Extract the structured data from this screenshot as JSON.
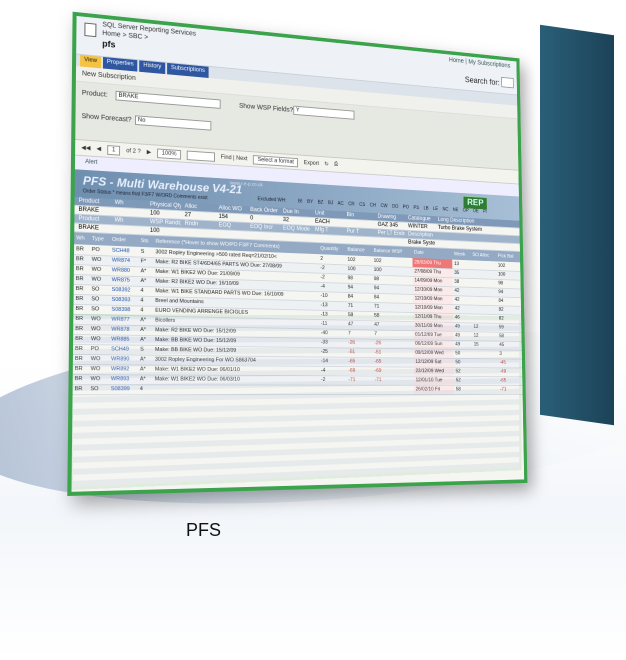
{
  "window": {
    "app_title": "SQL Server Reporting Services",
    "breadcrumb": "Home > SBC >",
    "page_title": "pfs",
    "home_link": "Home | My Subscriptions",
    "search_label": "Search for:"
  },
  "tabs": [
    "View",
    "Properties",
    "History",
    "Subscriptions"
  ],
  "subscription_link": "New Subscription",
  "params": {
    "product_label": "Product:",
    "product_value": "BRAKE",
    "show_wsp_label": "Show WSP Fields?",
    "show_wsp_value": "Y",
    "show_forecast_label": "Show Forecast?",
    "show_forecast_value": "No"
  },
  "toolbar": {
    "page": "1",
    "of_pages": "of 2 ?",
    "zoom": "100%",
    "find_next": "Find | Next",
    "format": "Select a format",
    "export": "Export"
  },
  "alert_label": "Alert",
  "report": {
    "title": "PFS - Multi Warehouse V4-21",
    "url": "www.r-e-p.co.uk",
    "logo": "REP",
    "note": "Order Status * means that F3/F7 W/ORD Comments exist",
    "excluded": "Excluded WH:",
    "categories": "BI BY BZ BJ AC CR CS CH CW DO PO PS LB LE NC NE OP OE PI"
  },
  "info_rows": [
    [
      "Product",
      "Wh",
      "Physical Qty",
      "Alloc",
      "Alloc WO",
      "Back Order Qty",
      "Due In",
      "Unit",
      "Bin",
      "Drawing",
      "Catalogue",
      "Long Description"
    ],
    [
      "BRAKE",
      "",
      "100",
      "27",
      "154",
      "0",
      "32",
      "EACH",
      "",
      "GAZ 345",
      "WINTER",
      "Turbo Brake System"
    ],
    [
      "Product",
      "Wh",
      "WSP Random %",
      "Rndn",
      "EOQ",
      "EOQ Incr",
      "EOQ Mode",
      "Mfg T",
      "Pur T",
      "Per LT Ends",
      "Description",
      ""
    ],
    [
      "BRAKE",
      "",
      "100",
      "",
      "",
      "",
      "",
      "",
      "",
      "",
      "Brake System",
      ""
    ]
  ],
  "columns": [
    "Wh",
    "Type",
    "Order",
    "Sts",
    "Reference (*Hover to show WO/PO F3/F7 Comments)",
    "Quantity",
    "Balance",
    "Balance WSP",
    "Date",
    "Week",
    "SO Alloc",
    "Pick Bal"
  ],
  "rows": [
    [
      "BR",
      "PO",
      "SCH48",
      "S",
      "3002 Ropley Engineering >500 rated Req=21/02/10<",
      "2",
      "102",
      "102",
      "28/03/09 Thu",
      "13",
      "",
      "102"
    ],
    [
      "BR",
      "WO",
      "WR874",
      "F*",
      "Make: R2 BIKE ST4/6D4/65 PARTS WO Due: 27/08/09",
      "-2",
      "100",
      "100",
      "27/08/09 Thu",
      "35",
      "",
      "100"
    ],
    [
      "BR",
      "WO",
      "WR880",
      "A*",
      "Make: W1 BIKE2 WO Due: 21/09/09",
      "-2",
      "98",
      "98",
      "14/09/09 Mon",
      "38",
      "",
      "98"
    ],
    [
      "BR",
      "WO",
      "WR875",
      "A*",
      "Make: R2 BIKE2 WO Due: 16/10/09",
      "-4",
      "94",
      "94",
      "12/10/09 Mon",
      "42",
      "",
      "94"
    ],
    [
      "BR",
      "SO",
      "S08392",
      "4",
      "Make: W1 BIKE STANDARD PARTS WO Due: 16/10/09",
      "-10",
      "84",
      "84",
      "12/10/09 Mon",
      "42",
      "",
      "84"
    ],
    [
      "BR",
      "SO",
      "S08393",
      "4",
      "Breel and Mountains",
      "-13",
      "71",
      "71",
      "12/10/09 Mon",
      "42",
      "",
      "82"
    ],
    [
      "BR",
      "SO",
      "S08398",
      "4",
      "EURO VENDING ARRENGE BICIGLES",
      "-13",
      "58",
      "58",
      "12/11/09 Thu",
      "46",
      "",
      "82"
    ],
    [
      "BR",
      "WO",
      "WR877",
      "A*",
      "Bicollers",
      "-11",
      "47",
      "47",
      "30/11/09 Mon",
      "49",
      "12",
      "59"
    ],
    [
      "BR",
      "WO",
      "WR878",
      "A*",
      "Make: R2 BIKE WO Due: 15/12/09",
      "-40",
      "7",
      "7",
      "01/12/09 Tue",
      "49",
      "12",
      "58"
    ],
    [
      "BR",
      "WO",
      "WR885",
      "A*",
      "Make: BB BIKE WO Due: 15/12/09",
      "-33",
      "-26",
      "-26",
      "06/12/09 Sun",
      "49",
      "15",
      "45"
    ],
    [
      "BR",
      "PO",
      "SCH49",
      "S",
      "Make: BB BIKE WO Due: 15/12/09",
      "-25",
      "-51",
      "-51",
      "09/12/09 Wed",
      "50",
      "",
      "3"
    ],
    [
      "BR",
      "WO",
      "WR890",
      "A*",
      "3002 Ropley Engineering For WO S863704",
      "-14",
      "-65",
      "-65",
      "12/12/09 Sat",
      "50",
      "",
      "-45"
    ],
    [
      "BR",
      "WO",
      "WR892",
      "A*",
      "Make: W1 BIKE2 WO Due: 06/01/10",
      "-4",
      "-69",
      "-69",
      "23/12/09 Wed",
      "52",
      "",
      "-49"
    ],
    [
      "BR",
      "WO",
      "WR893",
      "A*",
      "Make: W1 BIKE2 WO Due: 06/03/10",
      "-2",
      "-71",
      "-71",
      "12/01/10 Tue",
      "52",
      "",
      "-65"
    ],
    [
      "BR",
      "SO",
      "S08399",
      "4",
      "",
      "",
      "",
      "",
      "26/02/10 Fri",
      "58",
      "",
      "-71"
    ]
  ],
  "caption": "PFS"
}
